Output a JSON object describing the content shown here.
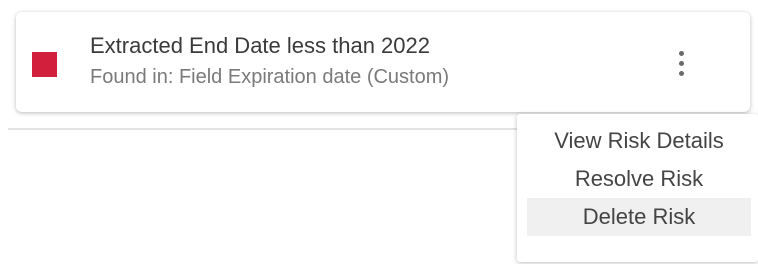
{
  "risk_card": {
    "title": "Extracted End Date less than 2022",
    "subtitle": "Found in: Field Expiration date (Custom)",
    "severity_color": "#d21f3c",
    "more_icon": "vertical-ellipsis-icon"
  },
  "context_menu": {
    "items": [
      {
        "label": "View Risk Details",
        "highlighted": false
      },
      {
        "label": "Resolve Risk",
        "highlighted": false
      },
      {
        "label": "Delete Risk",
        "highlighted": true
      }
    ]
  },
  "colors": {
    "highlight": "#f0f0f0",
    "text_primary": "#3a3a3a",
    "text_secondary": "#7a7a7a"
  }
}
